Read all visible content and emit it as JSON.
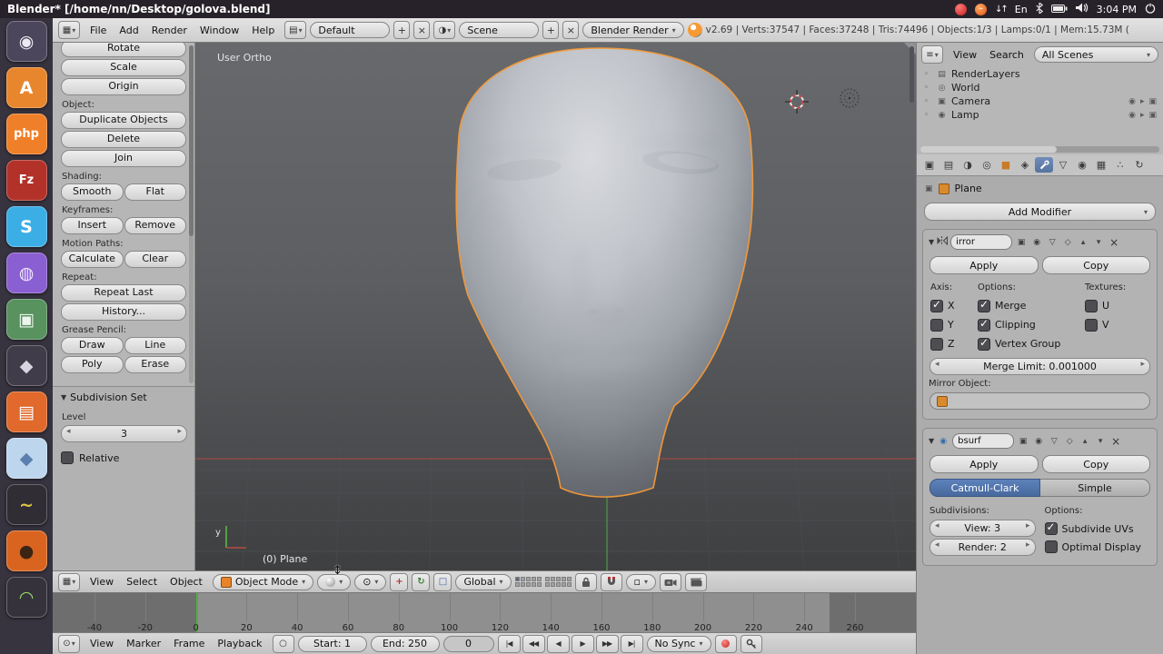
{
  "ubuntu_bar": {
    "title": "Blender* [/home/nn/Desktop/golova.blend]",
    "clock": "3:04 PM",
    "lang": "En"
  },
  "launcher": {
    "items": [
      {
        "name": "dash-home",
        "bg": "#4c465c",
        "fg": "#ece9f2",
        "glyph": "◉"
      },
      {
        "name": "app-a",
        "bg": "#e8862d",
        "fg": "#ffffff",
        "glyph": "A"
      },
      {
        "name": "php-app",
        "bg": "#ef7f28",
        "fg": "#ffffff",
        "glyph": "php"
      },
      {
        "name": "filezilla",
        "bg": "#b23229",
        "fg": "#ffffff",
        "glyph": "Fz"
      },
      {
        "name": "skype",
        "bg": "#3caee6",
        "fg": "#ffffff",
        "glyph": "S"
      },
      {
        "name": "media-player",
        "bg": "#8a5fd1",
        "fg": "#f0eaff",
        "glyph": "◍"
      },
      {
        "name": "image-viewer",
        "bg": "#58925f",
        "fg": "#eaf5ec",
        "glyph": "▣"
      },
      {
        "name": "game-controller",
        "bg": "#413c49",
        "fg": "#d8d4e0",
        "glyph": "◆"
      },
      {
        "name": "file-manager",
        "bg": "#e0692b",
        "fg": "#ffffff",
        "glyph": "▤"
      },
      {
        "name": "cube-app",
        "bg": "#bed5ee",
        "fg": "#5b7fae",
        "glyph": "◆"
      },
      {
        "name": "dark-app",
        "bg": "#302d35",
        "fg": "#e6c945",
        "glyph": "~"
      },
      {
        "name": "orange-ball-app",
        "bg": "#d9641f",
        "fg": "#3a2414",
        "glyph": "●"
      },
      {
        "name": "partial-app",
        "bg": "#35323c",
        "fg": "#9ae06a",
        "glyph": "◠"
      }
    ]
  },
  "top_header": {
    "menus": [
      "File",
      "Add",
      "Render",
      "Window",
      "Help"
    ],
    "layout": "Default",
    "scene": "Scene",
    "engine": "Blender Render",
    "stats": "v2.69 | Verts:37547 | Faces:37248 | Tris:74496 | Objects:1/3 | Lamps:0/1 | Mem:15.73M ("
  },
  "tool_shelf": {
    "sections": [
      {
        "label": "",
        "rows": [
          [
            "Rotate"
          ],
          [
            "Scale"
          ],
          [
            "Origin"
          ]
        ]
      },
      {
        "label": "Object:",
        "rows": [
          [
            "Duplicate Objects"
          ],
          [
            "Delete"
          ],
          [
            "Join"
          ]
        ]
      },
      {
        "label": "Shading:",
        "rows": [
          [
            "Smooth",
            "Flat"
          ]
        ]
      },
      {
        "label": "Keyframes:",
        "rows": [
          [
            "Insert",
            "Remove"
          ]
        ]
      },
      {
        "label": "Motion Paths:",
        "rows": [
          [
            "Calculate",
            "Clear"
          ]
        ]
      },
      {
        "label": "Repeat:",
        "rows": [
          [
            "Repeat Last"
          ],
          [
            "History..."
          ]
        ]
      },
      {
        "label": "Grease Pencil:",
        "rows": [
          [
            "Draw",
            "Line"
          ],
          [
            "Poly",
            "Erase"
          ]
        ]
      }
    ],
    "operator": {
      "title": "Subdivision Set",
      "level_label": "Level",
      "level_value": "3",
      "relative": "Relative",
      "relative_checked": false
    }
  },
  "viewport": {
    "view_label": "User Ortho",
    "active_object": "(0) Plane",
    "axis_label": "y"
  },
  "view3d_header": {
    "menus": [
      "View",
      "Select",
      "Object"
    ],
    "mode": "Object Mode",
    "orientation": "Global",
    "layers_active_index": 0
  },
  "timeline": {
    "menus": [
      "View",
      "Marker",
      "Frame",
      "Playback"
    ],
    "start": "Start: 1",
    "end": "End: 250",
    "frame": "0",
    "sync": "No Sync",
    "ticks": [
      "-40",
      "-20",
      "0",
      "20",
      "40",
      "60",
      "80",
      "100",
      "120",
      "140",
      "160",
      "180",
      "200",
      "220",
      "240",
      "260"
    ],
    "playback": [
      "jump-to-start",
      "prev-keyframe",
      "play-reverse",
      "play",
      "next-keyframe",
      "jump-to-end"
    ]
  },
  "outliner": {
    "menus": [
      "View",
      "Search"
    ],
    "filter": "All Scenes",
    "items": [
      {
        "label": "RenderLayers",
        "icon": "layers",
        "restrict": false
      },
      {
        "label": "World",
        "icon": "world",
        "restrict": false
      },
      {
        "label": "Camera",
        "icon": "camera",
        "restrict": true
      },
      {
        "label": "Lamp",
        "icon": "lamp",
        "restrict": true
      }
    ]
  },
  "properties": {
    "tabs": [
      "render",
      "render-layers",
      "scene",
      "world",
      "object",
      "constraints",
      "modifiers",
      "data",
      "material",
      "texture",
      "particles",
      "physics"
    ],
    "active_tab": "modifiers",
    "breadcrumb": "Plane",
    "add_modifier": "Add Modifier",
    "mirror": {
      "name": "irror",
      "apply": "Apply",
      "copy": "Copy",
      "axis_label": "Axis:",
      "options_label": "Options:",
      "textures_label": "Textures:",
      "axis": [
        {
          "label": "X",
          "checked": true
        },
        {
          "label": "Y",
          "checked": false
        },
        {
          "label": "Z",
          "checked": false
        }
      ],
      "options": [
        {
          "label": "Merge",
          "checked": true
        },
        {
          "label": "Clipping",
          "checked": true
        },
        {
          "label": "Vertex Group",
          "checked": true
        }
      ],
      "textures": [
        {
          "label": "U",
          "checked": false
        },
        {
          "label": "V",
          "checked": false
        }
      ],
      "merge_limit": "Merge Limit: 0.001000",
      "mirror_object_label": "Mirror Object:"
    },
    "subsurf": {
      "name": "bsurf",
      "apply": "Apply",
      "copy": "Copy",
      "types": [
        "Catmull-Clark",
        "Simple"
      ],
      "active_type": "Catmull-Clark",
      "subdivisions_label": "Subdivisions:",
      "view": "View: 3",
      "render": "Render: 2",
      "options_label": "Options:",
      "options": [
        {
          "label": "Subdivide UVs",
          "checked": true
        },
        {
          "label": "Optimal Display",
          "checked": false
        }
      ]
    }
  }
}
